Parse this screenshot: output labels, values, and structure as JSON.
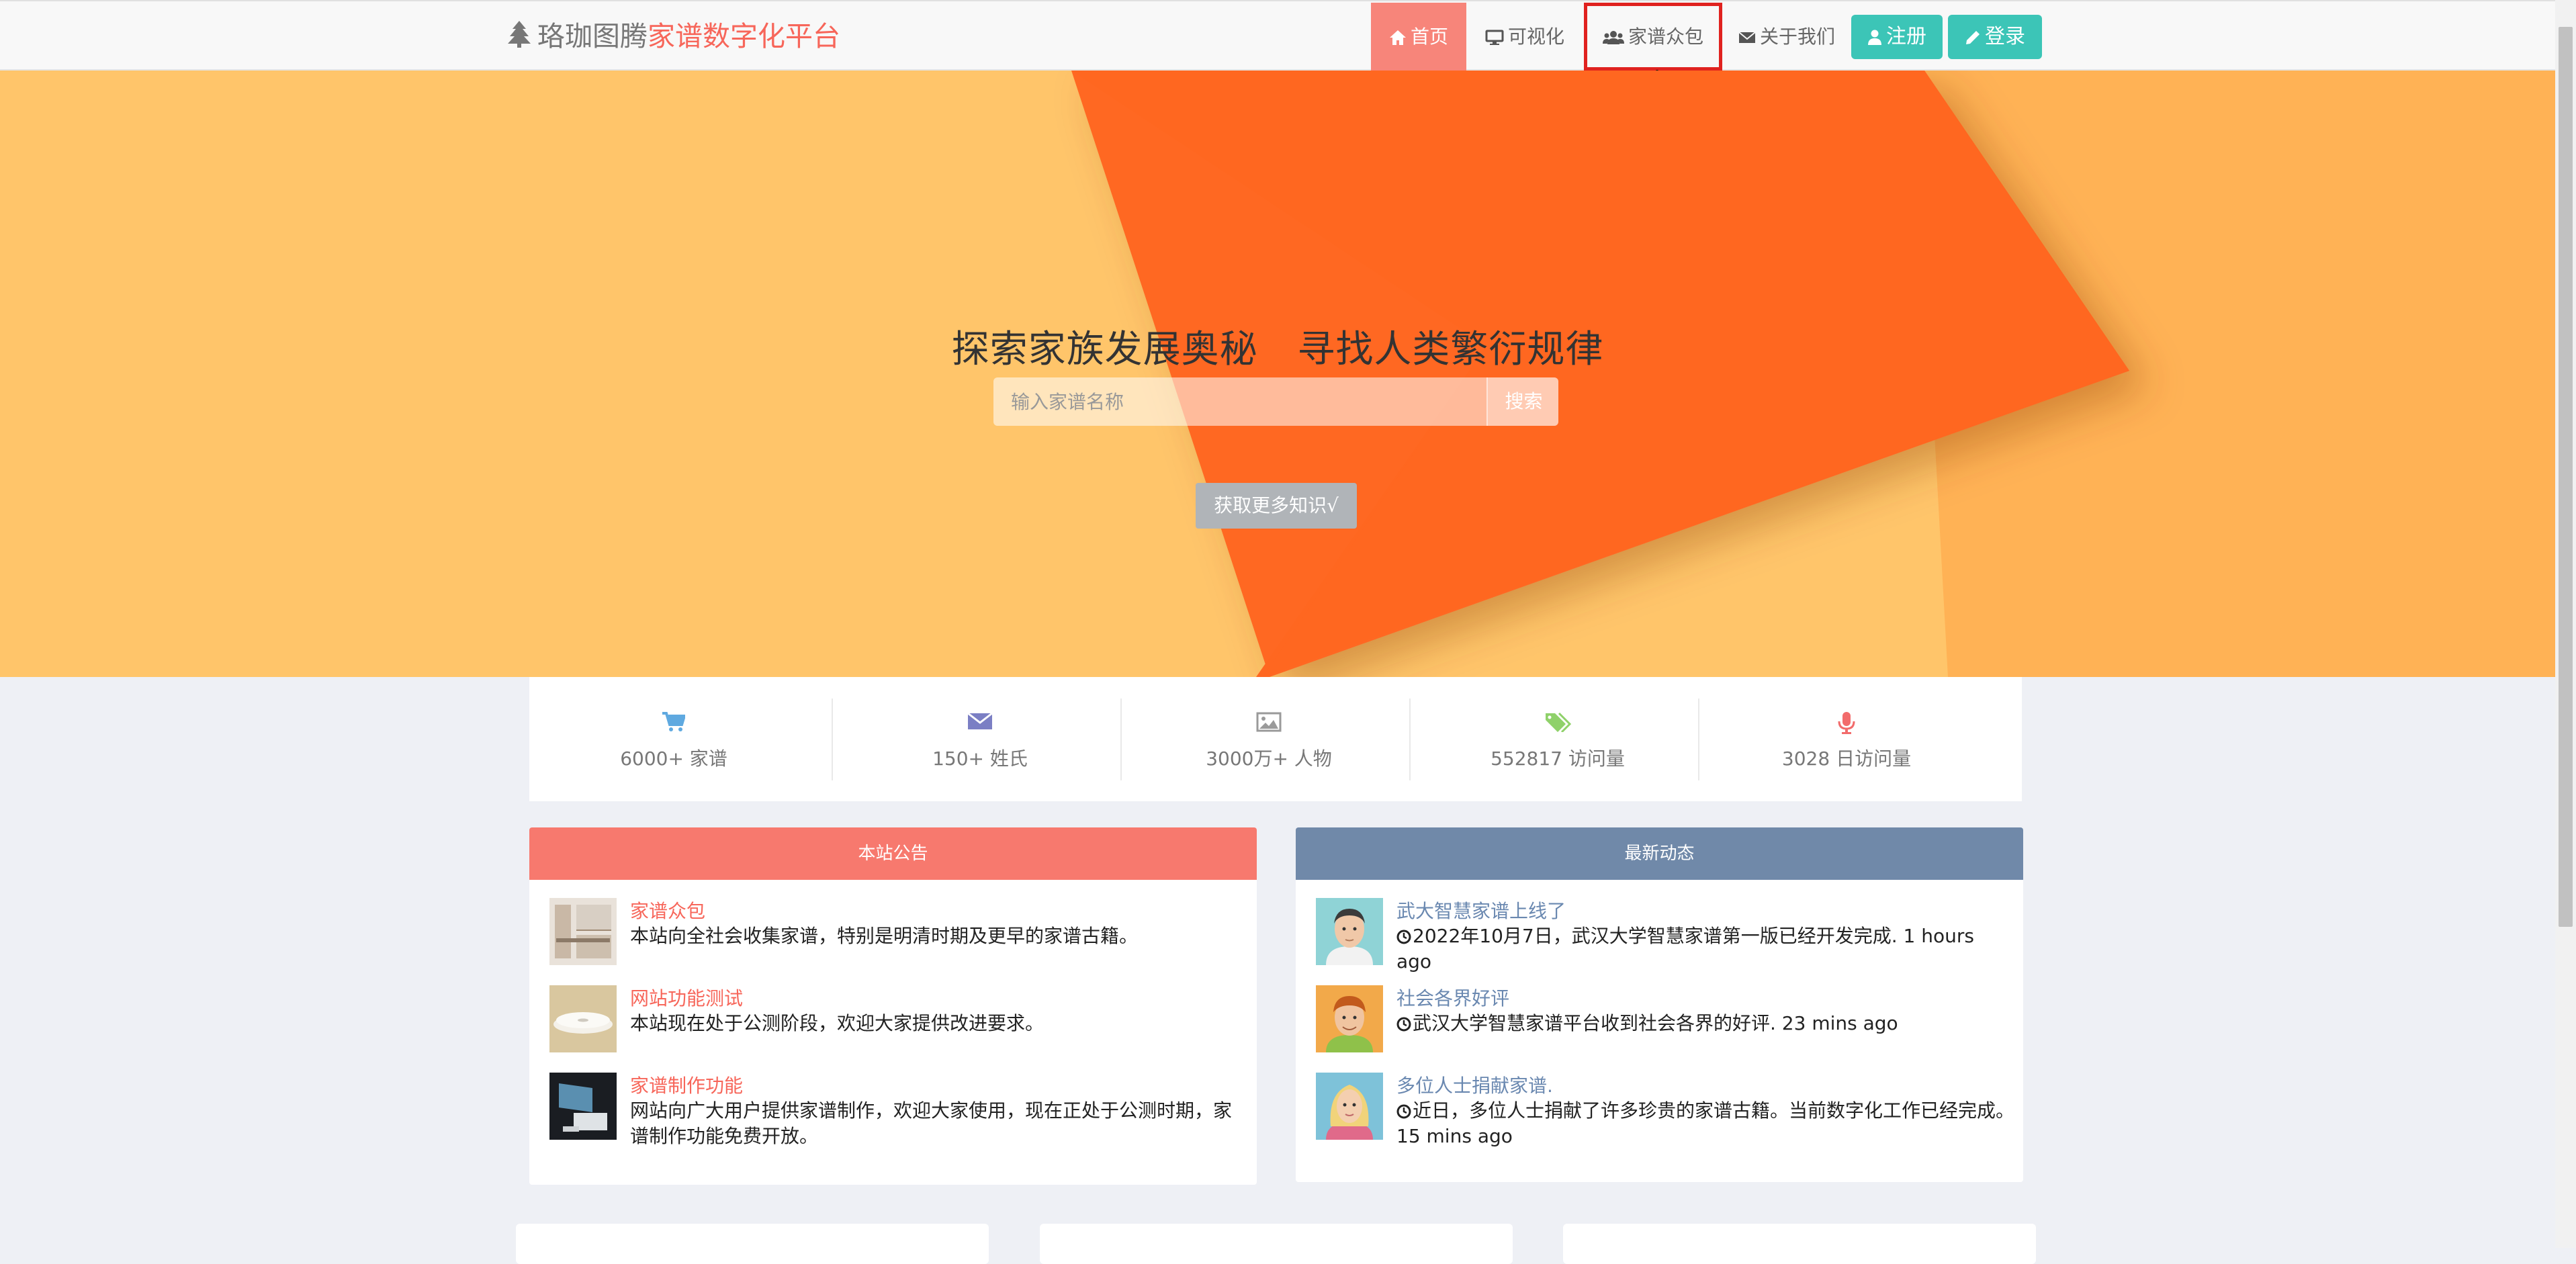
{
  "navbar": {
    "brand_prefix": "珞珈图腾",
    "brand_highlight": "家谱数字化平台",
    "items": [
      {
        "label": "首页",
        "icon": "home-icon"
      },
      {
        "label": "可视化",
        "icon": "monitor-icon"
      },
      {
        "label": "家谱众包",
        "icon": "users-icon"
      },
      {
        "label": "关于我们",
        "icon": "envelope-icon"
      }
    ],
    "register_label": "注册",
    "login_label": "登录"
  },
  "hero": {
    "title": "探索家族发展奥秘 寻找人类繁衍规律",
    "search_placeholder": "输入家谱名称",
    "search_button": "搜索",
    "more_button": "获取更多知识√"
  },
  "stats": [
    {
      "icon": "cart-icon",
      "color": "#5fa9e0",
      "text": "6000+ 家谱"
    },
    {
      "icon": "envelope-icon",
      "color": "#7b7fc4",
      "text": "150+ 姓氏"
    },
    {
      "icon": "image-icon",
      "color": "#9a9a9a",
      "text": "3000万+ 人物"
    },
    {
      "icon": "tags-icon",
      "color": "#8fd16a",
      "text": "552817 访问量"
    },
    {
      "icon": "microphone-icon",
      "color": "#f26b6b",
      "text": "3028 日访问量"
    }
  ],
  "announcements": {
    "header": "本站公告",
    "color": "#f7796e",
    "items": [
      {
        "title": "家谱众包",
        "desc": "本站向全社会收集家谱，特别是明清时期及更早的家谱古籍。"
      },
      {
        "title": "网站功能测试",
        "desc": "本站现在处于公测阶段，欢迎大家提供改进要求。"
      },
      {
        "title": "家谱制作功能",
        "desc": "网站向广大用户提供家谱制作，欢迎大家使用，现在正处于公测时期，家谱制作功能免费开放。"
      }
    ]
  },
  "updates": {
    "header": "最新动态",
    "color": "#7089a9",
    "items": [
      {
        "title": "武大智慧家谱上线了",
        "desc": "2022年10月7日，武汉大学智慧家谱第一版已经开发完成. 1 hours ago"
      },
      {
        "title": "社会各界好评",
        "desc": "武汉大学智慧家谱平台收到社会各界的好评. 23 mins ago"
      },
      {
        "title": "多位人士捐献家谱.",
        "desc": "近日，多位人士捐献了许多珍贵的家谱古籍。当前数字化工作已经完成。 15 mins ago"
      }
    ]
  }
}
